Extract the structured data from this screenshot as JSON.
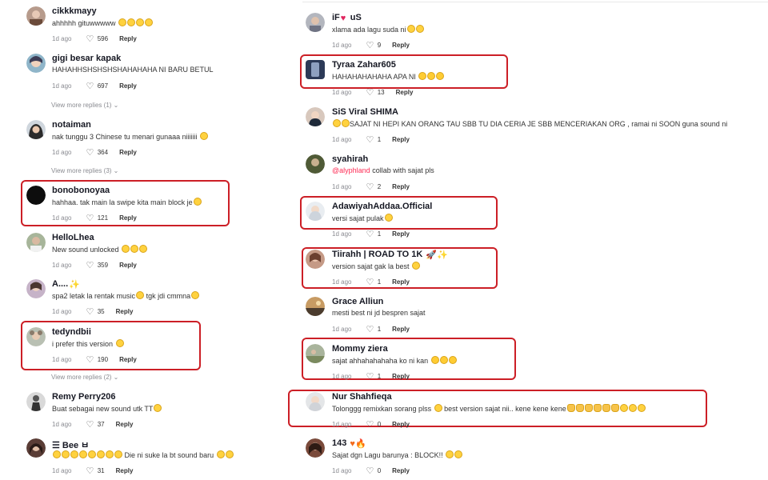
{
  "ui": {
    "view_more_chevron": "⌄"
  },
  "left": [
    {
      "name": "cikkkmayy",
      "text": "ahhhhh gituwwwww",
      "emojis": "😂😂😂😂",
      "time": "1d ago",
      "likes": "596",
      "reply": "Reply"
    },
    {
      "name": "gigi besar kapak",
      "text": "HAHAHHSHSHSHSHAHAHAHA NI BARU BETUL",
      "emojis": "",
      "time": "1d ago",
      "likes": "697",
      "reply": "Reply",
      "view_more": "View more replies (1)"
    },
    {
      "name": "notaiman",
      "text": "nak tunggu 3 Chinese tu menari gunaaa niiiiiii",
      "emojis": "😂",
      "time": "1d ago",
      "likes": "364",
      "reply": "Reply",
      "view_more": "View more replies (3)"
    },
    {
      "name": "bonobonoyaa",
      "text": "hahhaa. tak main la swipe kita main block je",
      "emojis": "😂",
      "time": "1d ago",
      "likes": "121",
      "reply": "Reply",
      "highlight": true
    },
    {
      "name": "HelloLhea",
      "text": "New sound unlocked",
      "emojis": "😂😂😂",
      "time": "1d ago",
      "likes": "359",
      "reply": "Reply"
    },
    {
      "name": "A....",
      "name_emoji": "✨",
      "text": "spa2 letak la rentak music",
      "text_after": "tgk jdi cmmna",
      "emojis": "😂",
      "emojis_after": "😂",
      "time": "1d ago",
      "likes": "35",
      "reply": "Reply"
    },
    {
      "name": "tedyndbii",
      "text": "i prefer this version",
      "emojis": "😂",
      "time": "1d ago",
      "likes": "190",
      "reply": "Reply",
      "highlight": true,
      "view_more": "View more replies (2)"
    },
    {
      "name": "Remy Perry206",
      "text": "Buat sebagai new sound utk TT",
      "emojis": "😂",
      "time": "1d ago",
      "likes": "37",
      "reply": "Reply"
    },
    {
      "name": "☰ Bee ㅂ",
      "text": "",
      "emojis": "😂😂😂😂😂😂😂😂",
      "text_after": "Die ni suke la bt sound baru",
      "emojis_after": "😂😂",
      "time": "1d ago",
      "likes": "31",
      "reply": "Reply"
    }
  ],
  "right": [
    {
      "name": "iF",
      "name_emoji": "♥",
      "name_after": "uS",
      "text": "xlama ada lagu suda ni",
      "emojis": "😂😂",
      "time": "1d ago",
      "likes": "9",
      "reply": "Reply"
    },
    {
      "name": "Tyraa Zahar605",
      "text": "HAHAHAHAHAHA APA NI",
      "emojis": "🤣🤣🤣",
      "time": "1d ago",
      "likes": "13",
      "reply": "Reply",
      "highlight": true
    },
    {
      "name": "SiS Viral SHIMA",
      "text": "SAJAT NI HEPI KAN ORANG TAU SBB TU DIA CERIA JE SBB MENCERIAKAN ORG , ramai ni SOON guna sound ni",
      "emojis_before": "😂😂",
      "time": "1d ago",
      "likes": "1",
      "reply": "Reply"
    },
    {
      "name": "syahirah",
      "mention": "@alyphland",
      "text": "collab with sajat pls",
      "time": "1d ago",
      "likes": "2",
      "reply": "Reply"
    },
    {
      "name": "AdawiyahAddaa.Official",
      "text": "versi sajat pulak",
      "emojis": "😂",
      "time": "1d ago",
      "likes": "1",
      "reply": "Reply",
      "highlight": true
    },
    {
      "name": "Tiirahh | ROAD TO 1K",
      "name_emoji": "🚀✨",
      "text": "version sajat gak la best",
      "emojis": "😂",
      "time": "1d ago",
      "likes": "1",
      "reply": "Reply",
      "highlight": true
    },
    {
      "name": "Grace Alliun",
      "text": "mesti best ni jd bespren sajat",
      "time": "1d ago",
      "likes": "1",
      "reply": "Reply"
    },
    {
      "name": "Mommy ziera",
      "text": "sajat ahhahahahaha ko ni kan",
      "emojis": "🤣🤣🤣",
      "time": "1d ago",
      "likes": "1",
      "reply": "Reply",
      "highlight": true
    },
    {
      "name": "Nur Shahfieqa",
      "text": "Tolonggg remixkan sorang plss",
      "emojis": "😂",
      "text_after": "best version sajat nii.. kene kene kene",
      "emojis_after": "👍👍👍👍👍👍😂😂😂",
      "time": "1d ago",
      "likes": "0",
      "reply": "Reply",
      "highlight": true
    },
    {
      "name": "143",
      "name_emoji": "♥🔥",
      "text": "Sajat dgn Lagu barunya : BLOCK!!",
      "emojis": "😂😂",
      "time": "1d ago",
      "likes": "0",
      "reply": "Reply"
    }
  ],
  "colors": {
    "highlight_border": "#cc1f26",
    "mention": "#fe2c55",
    "meta": "#8a8b91"
  }
}
